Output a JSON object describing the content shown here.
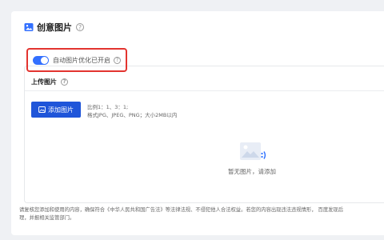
{
  "section": {
    "title": "创意图片",
    "help_icon": "?"
  },
  "toggle": {
    "label": "自动图片优化已开启",
    "enabled": true,
    "on_color": "#3370ff",
    "help_icon": "?"
  },
  "upload": {
    "title": "上传图片",
    "help_icon": "?",
    "add_button_label": "添加图片",
    "rule_ratio": "比例1：1、3：1;",
    "rule_format": "格式JPG、JPEG、PNG；大小2MB以内",
    "empty_text": "暂无图片，请添加",
    "button_color": "#1f55d9"
  },
  "notice": {
    "line1": "请复核您添加和使用的内容，确保符合《中华人民共和国广告法》等法律法规、不侵犯他人合法权益。若您的内容出现违法违规情形，  百度发现后",
    "line2": "理，并报相关监管部门。"
  },
  "highlight_color": "#e3342f"
}
